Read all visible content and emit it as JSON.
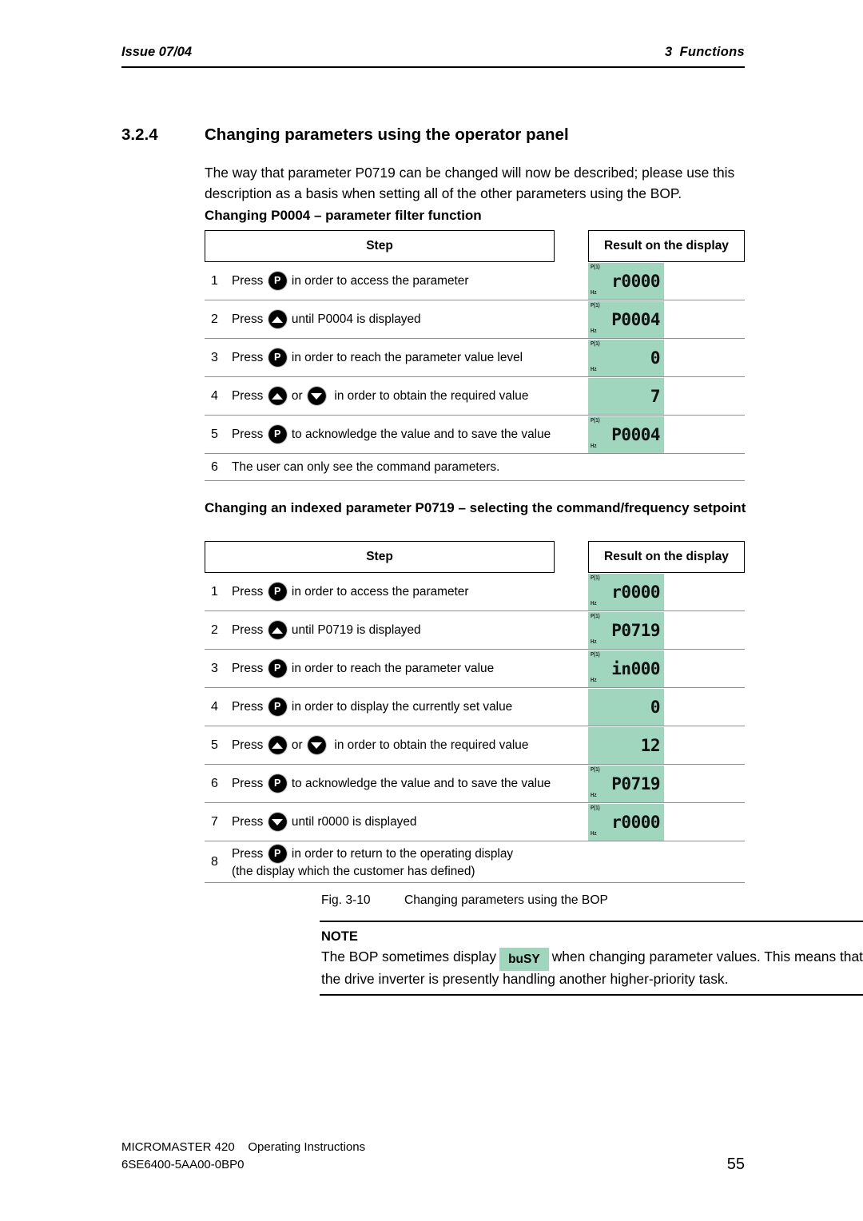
{
  "header": {
    "left": "Issue 07/04",
    "right_num": "3",
    "right_title": "Functions"
  },
  "section": {
    "number": "3.2.4",
    "title": "Changing parameters using the operator panel",
    "intro": "The way that parameter P0719 can be changed will now be described; please use this description as a basis when setting all of the other parameters using the BOP."
  },
  "table1": {
    "subheading": "Changing P0004 – parameter filter function",
    "col_step": "Step",
    "col_result": "Result on the display",
    "rows": [
      {
        "num": "1",
        "pre": "Press ",
        "key": "p-key",
        "post": " in order to access the parameter",
        "display": {
          "value": "r0000",
          "top_label": "P(1)",
          "bottom_label": "Hz"
        }
      },
      {
        "num": "2",
        "pre": "Press ",
        "key": "up-key",
        "post": " until P0004 is displayed",
        "display": {
          "value": "P0004",
          "top_label": "P(1)",
          "bottom_label": "Hz"
        }
      },
      {
        "num": "3",
        "pre": "Press ",
        "key": "p-key",
        "post": " in order to reach the parameter value level",
        "display": {
          "value": "0",
          "top_label": "P(1)",
          "bottom_label": "Hz"
        }
      },
      {
        "num": "4",
        "pre": "Press ",
        "key": "up-key",
        "mid": " or ",
        "key2": "down-key",
        "post": "  in order to obtain the required value",
        "display": {
          "value": "7",
          "top_label": "",
          "bottom_label": ""
        }
      },
      {
        "num": "5",
        "pre": "Press ",
        "key": "p-key",
        "post": " to acknowledge the value and to save the value",
        "display": {
          "value": "P0004",
          "top_label": "P(1)",
          "bottom_label": "Hz"
        }
      },
      {
        "num": "6",
        "pre": "The user can only see the command parameters.",
        "key": "",
        "post": "",
        "display": null
      }
    ]
  },
  "table2": {
    "subheading": "Changing an indexed parameter P0719 – selecting the command/frequency setpoint",
    "col_step": "Step",
    "col_result": "Result on the display",
    "rows": [
      {
        "num": "1",
        "pre": "Press ",
        "key": "p-key",
        "post": " in order to access the parameter",
        "display": {
          "value": "r0000",
          "top_label": "P(1)",
          "bottom_label": "Hz"
        }
      },
      {
        "num": "2",
        "pre": "Press ",
        "key": "up-key",
        "post": " until P0719 is displayed",
        "display": {
          "value": "P0719",
          "top_label": "P(1)",
          "bottom_label": "Hz"
        }
      },
      {
        "num": "3",
        "pre": "Press ",
        "key": "p-key",
        "post": " in order to reach the parameter value",
        "display": {
          "value": "in000",
          "top_label": "P(1)",
          "bottom_label": "Hz"
        }
      },
      {
        "num": "4",
        "pre": "Press ",
        "key": "p-key",
        "post": " in order to display the currently set value",
        "display": {
          "value": "0",
          "top_label": "",
          "bottom_label": ""
        }
      },
      {
        "num": "5",
        "pre": "Press ",
        "key": "up-key",
        "mid": " or ",
        "key2": "down-key",
        "post": "  in order to obtain the required value",
        "display": {
          "value": "12",
          "top_label": "",
          "bottom_label": ""
        }
      },
      {
        "num": "6",
        "pre": "Press ",
        "key": "p-key",
        "post": " to acknowledge the value and to save the value",
        "display": {
          "value": "P0719",
          "top_label": "P(1)",
          "bottom_label": "Hz"
        }
      },
      {
        "num": "7",
        "pre": "Press ",
        "key": "down-key",
        "post": " until r0000 is displayed",
        "display": {
          "value": "r0000",
          "top_label": "P(1)",
          "bottom_label": "Hz"
        }
      },
      {
        "num": "8",
        "pre": "Press ",
        "key": "p-key",
        "post": " in order to return to the operating display",
        "post2": "(the display which the customer has defined)",
        "display": null
      }
    ]
  },
  "figure": {
    "label": "Fig. 3-10",
    "caption": "Changing parameters using the BOP"
  },
  "note": {
    "title": "NOTE",
    "text_before": "The BOP sometimes display",
    "badge": "buSY",
    "text_after": "when changing parameter values. This means that the drive inverter is presently handling another higher-priority task."
  },
  "footer": {
    "line1": "MICROMASTER 420    Operating Instructions",
    "line2": "6SE6400-5AA00-0BP0",
    "page": "55"
  },
  "colors": {
    "lcd_background": "#9fd6bd",
    "rule": "#000000",
    "row_separator": "#8f8f8f"
  }
}
